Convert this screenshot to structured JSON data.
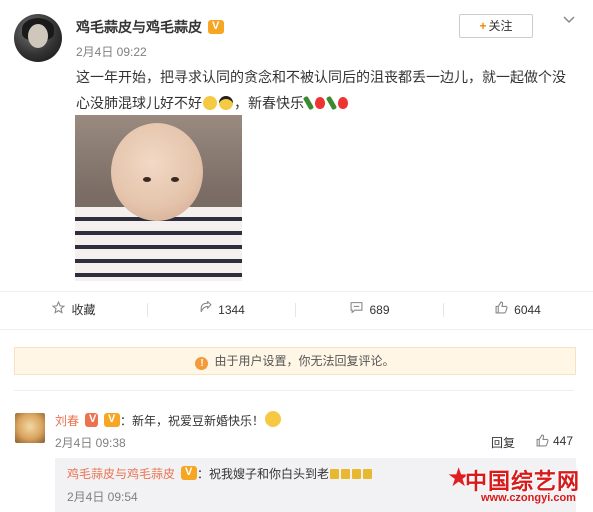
{
  "post": {
    "author": "鸡毛蒜皮与鸡毛蒜皮",
    "time": "2月4日 09:22",
    "follow_label": "关注",
    "text_main": "这一年开始，把寻求认同的贪念和不被认同后的沮丧都丢一边儿，就一起做个没心没肺混球儿好不好",
    "text_tail": "，新春快乐"
  },
  "actions": {
    "favorite": "收藏",
    "repost": "1344",
    "comment": "689",
    "like": "6044"
  },
  "notice": "由于用户设置，你无法回复评论。",
  "comment": {
    "author": "刘春",
    "text": "：新年，祝爱豆新婚快乐！",
    "time": "2月4日 09:38",
    "reply_label": "回复",
    "likes": "447"
  },
  "subcomment": {
    "author": "鸡毛蒜皮与鸡毛蒜皮",
    "text": "：祝我嫂子和你白头到老",
    "time": "2月4日 09:54"
  },
  "watermark": {
    "title": "中国综艺网",
    "url": "www.czongyi.com"
  },
  "colors": {
    "accent": "#ff8200",
    "name_link": "#eb7350",
    "notice_bg": "#fff6e6"
  },
  "icons": {
    "favorite": "star-icon",
    "repost": "repost-icon",
    "comment": "comment-icon",
    "like": "thumbs-up-icon",
    "notice": "warning-icon"
  }
}
